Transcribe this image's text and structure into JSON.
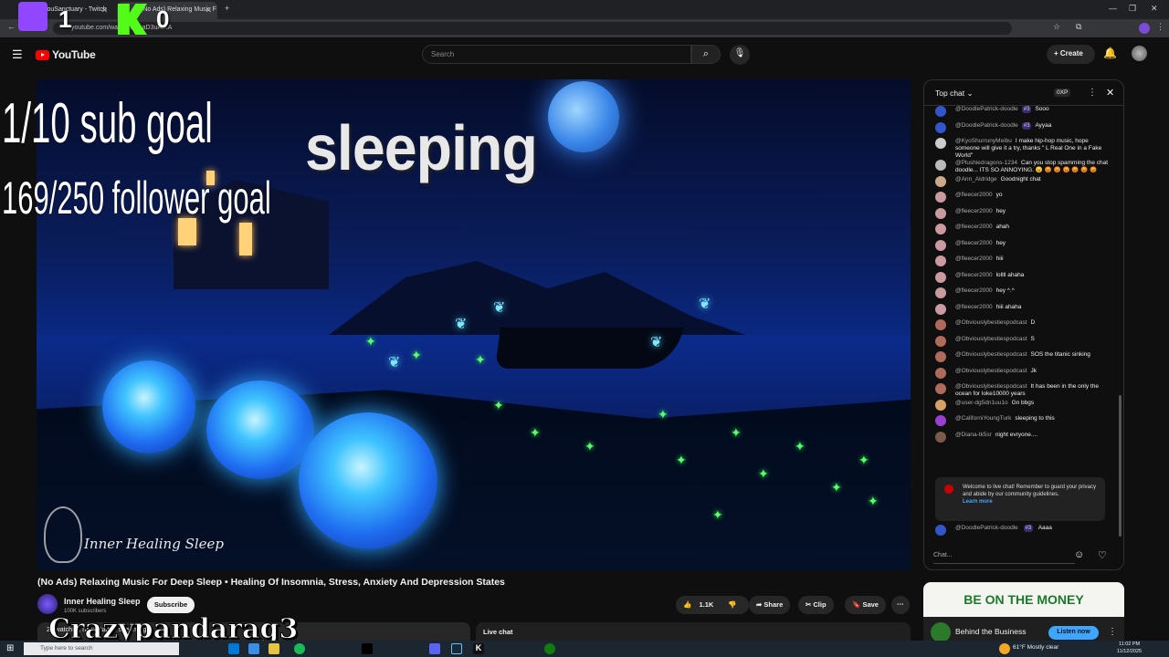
{
  "browser": {
    "tabs": [
      {
        "title": "vouSanctuary - Twitch",
        "active": false
      },
      {
        "title": "(No Ads) Relaxing Music F",
        "active": true
      }
    ],
    "url": "youtube.com/watch?v=...aD3uAtKA"
  },
  "youtube": {
    "logo_text": "YouTube",
    "search_placeholder": "Search",
    "create_label": "Create"
  },
  "overlay": {
    "twitch_count": "1",
    "kick_count": "0",
    "sub_goal": "1/10 sub goal",
    "follower_goal": "169/250 follower goal",
    "status_text": "sleeping",
    "streamer_name": "Crazypandarag3",
    "video_brand": "Inner Healing Sleep"
  },
  "video": {
    "title": "(No Ads) Relaxing Music For Deep Sleep • Healing Of Insomnia, Stress, Anxiety And Depression States",
    "channel": "Inner Healing Sleep",
    "subscribers": "100K subscribers",
    "subscribe_label": "Subscribe",
    "likes": "1.1K",
    "share_label": "Share",
    "clip_label": "Clip",
    "save_label": "Save",
    "description_snippet": "25 watching now  Started streaming",
    "live_chat_label": "Live chat"
  },
  "chat": {
    "mode_label": "Top chat",
    "xp_label": "0XP",
    "input_placeholder": "Chat...",
    "notice_text": "Welcome to live chat! Remember to guard your privacy and abide by our community guidelines.",
    "notice_link": "Learn more",
    "messages": [
      {
        "author": "@DoodlePatrick-doodle",
        "badge": "#3",
        "text": "Sooo",
        "color": "#3355cc"
      },
      {
        "author": "@DoodlePatrick-doodle",
        "badge": "#3",
        "text": "Ayyaa",
        "color": "#3355cc"
      },
      {
        "author": "@KyoShurrunyMeibu",
        "badge": "",
        "text": "I make hip-hop music, hope someone will give it a try, thanks \" L Real One in a Fake World\"",
        "color": "#cccccc"
      },
      {
        "author": "@Plushiedragons-1234",
        "badge": "",
        "text": "Can you stop spamming the chat doodle... ITS SO ANNOYING. 😠 😡 😡 😡 😡 😡 😡",
        "color": "#bbbbbb"
      },
      {
        "author": "@Ann_Aldridge",
        "badge": "",
        "text": "Goodnight chat",
        "color": "#c9a98a"
      },
      {
        "author": "@fleecer2000",
        "badge": "",
        "text": "yo",
        "color": "#c99aa0"
      },
      {
        "author": "@fleecer2000",
        "badge": "",
        "text": "hey",
        "color": "#c99aa0"
      },
      {
        "author": "@fleecer2000",
        "badge": "",
        "text": "ahah",
        "color": "#c99aa0"
      },
      {
        "author": "@fleecer2000",
        "badge": "",
        "text": "hey",
        "color": "#c99aa0"
      },
      {
        "author": "@fleecer2000",
        "badge": "",
        "text": "hiii",
        "color": "#c99aa0"
      },
      {
        "author": "@fleecer2000",
        "badge": "",
        "text": "lollll ahaha",
        "color": "#c99aa0"
      },
      {
        "author": "@fleecer2000",
        "badge": "",
        "text": "hey ^.^",
        "color": "#c99aa0"
      },
      {
        "author": "@fleecer2000",
        "badge": "",
        "text": "hiii ahaha",
        "color": "#c99aa0"
      },
      {
        "author": "@Obviouslybestiespodcast",
        "badge": "",
        "text": "D",
        "color": "#b06a5a"
      },
      {
        "author": "@Obviouslybestiespodcast",
        "badge": "",
        "text": "S",
        "color": "#b06a5a"
      },
      {
        "author": "@Obviouslybestiespodcast",
        "badge": "",
        "text": "SOS the titanic sinking",
        "color": "#b06a5a"
      },
      {
        "author": "@Obviouslybestiespodcast",
        "badge": "",
        "text": "Jk",
        "color": "#b06a5a"
      },
      {
        "author": "@Obviouslybestiespodcast",
        "badge": "",
        "text": "It has been in the only the ocean for loke10000 years",
        "color": "#b06a5a"
      },
      {
        "author": "@user-dg5dn1uu1o",
        "badge": "",
        "text": "Gn bbgs",
        "color": "#d9a066"
      },
      {
        "author": "@CaliforniYoungTurk",
        "badge": "",
        "text": "sleeping to this",
        "color": "#9b3fd1"
      },
      {
        "author": "@Diana-tk5sr",
        "badge": "",
        "text": "night evryone....",
        "color": "#7a5a4a"
      }
    ],
    "last_message": {
      "author": "@DoodlePatrick-doodle",
      "badge": "#3",
      "text": "Aaaa",
      "color": "#3355cc"
    }
  },
  "ad": {
    "banner": "BE ON THE MONEY",
    "title": "Behind the Business",
    "cta": "Listen now"
  },
  "taskbar": {
    "search_placeholder": "Type here to search",
    "weather": "61°F  Mostly clear",
    "time": "11:02 PM",
    "date": "11/12/2025"
  }
}
